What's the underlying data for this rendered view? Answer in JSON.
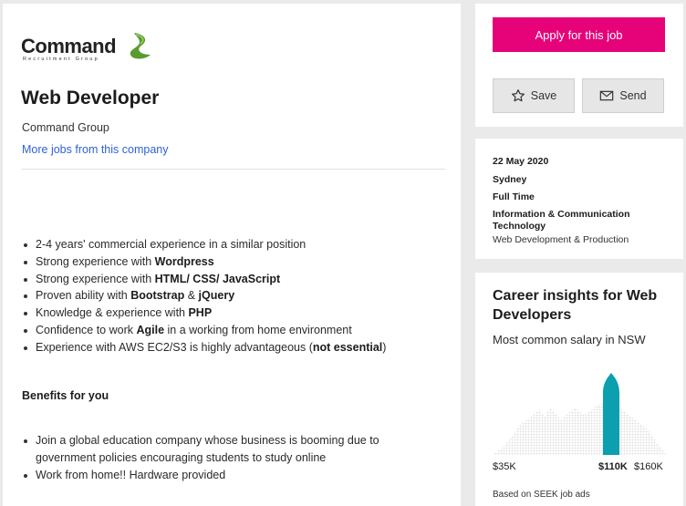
{
  "company": {
    "logo_name": "Command",
    "logo_tagline": "Recruitment Group",
    "name": "Command Group",
    "more_jobs_link": "More jobs from this company"
  },
  "job": {
    "title": "Web Developer",
    "requirements": [
      {
        "pre": "2-4 years' commercial experience in a similar position"
      },
      {
        "pre": "Strong experience with ",
        "bold": "Wordpress"
      },
      {
        "pre": "Strong experience with ",
        "bold": "HTML/ CSS/ JavaScript"
      },
      {
        "pre": "Proven ability with ",
        "bold": "Bootstrap",
        "mid": " & ",
        "bold2": "jQuery"
      },
      {
        "pre": "Knowledge & experience with ",
        "bold": "PHP"
      },
      {
        "pre": "Confidence to work ",
        "bold": "Agile",
        "post": " in a working from home environment"
      },
      {
        "pre": "Experience with AWS EC2/S3 is highly advantageous (",
        "bold": "not essential",
        "post": ")"
      }
    ],
    "benefits_heading": "Benefits for you",
    "benefits": [
      "Join a global education company whose business is booming due to government policies encouraging students to study online",
      "Work from home!! Hardware provided"
    ]
  },
  "actions": {
    "apply_label": "Apply for this job",
    "save_label": "Save",
    "send_label": "Send"
  },
  "meta": {
    "date": "22 May 2020",
    "location": "Sydney",
    "work_type": "Full Time",
    "classification": "Information & Communication Technology",
    "sub_classification": "Web Development & Production"
  },
  "insights": {
    "title": "Career insights for Web Developers",
    "subtitle": "Most common salary in NSW",
    "based_on": "Based on SEEK job ads"
  },
  "chart_data": {
    "type": "area",
    "tick_labels": [
      "$35K",
      "$110K",
      "$160K"
    ],
    "x_range": [
      35,
      160
    ],
    "highlight_x": 110,
    "highlight_label": "$110K",
    "highlight_color": "#0b9fb0",
    "distribution_color": "#e3e3e3"
  },
  "colors": {
    "apply_bg": "#e60278",
    "link": "#2e62d6",
    "accent_teal": "#0b9fb0"
  },
  "icons": {
    "save": "star-icon",
    "send": "mail-icon",
    "logo": "swoosh-icon"
  }
}
